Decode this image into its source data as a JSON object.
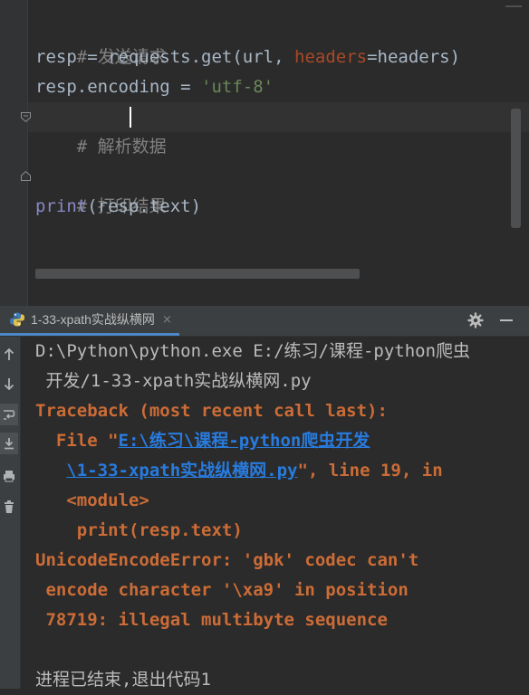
{
  "editor": {
    "lines": [
      {
        "comment": "# 发送请求"
      },
      {
        "var": "resp",
        "eq": " = ",
        "call": "requests.get(url, ",
        "param": "headers",
        "rest": "=headers)"
      },
      {
        "var": "resp.encoding",
        "eq": " = ",
        "str": "'utf-8'"
      },
      {
        "comment": "# 解析数据"
      },
      {
        "comment": "# 打印结果"
      },
      {
        "builtin": "print",
        "args": "(resp.text)"
      }
    ]
  },
  "run": {
    "tab_label": "1-33-xpath实战纵横网",
    "tab_close": "×",
    "settings_icon": "gear-icon",
    "minimize_icon": "minimize-icon"
  },
  "console": {
    "cmd_line1": "D:\\Python\\python.exe E:/练习/课程-python爬虫",
    "cmd_line2": " 开发/1-33-xpath实战纵横网.py",
    "traceback": "Traceback (most recent call last):",
    "file_prefix": "  File \"",
    "file_link1": "E:\\练习\\课程-python爬虫开发",
    "file_link2": "\\1-33-xpath实战纵横网.py",
    "file_suffix": "\", line 19, in",
    "module_line": "   <module>",
    "code_line": "    print(resp.text)",
    "error_line1": "UnicodeEncodeError: 'gbk' codec can't",
    "error_line2": " encode character '\\xa9' in position",
    "error_line3": " 78719: illegal multibyte sequence",
    "exit_line": "进程已结束,退出代码1"
  },
  "colors": {
    "background": "#2b2b2b",
    "error": "#cc6c36",
    "link": "#287bde",
    "comment": "#808080",
    "string": "#6a8759",
    "keyword": "#cc7832"
  }
}
